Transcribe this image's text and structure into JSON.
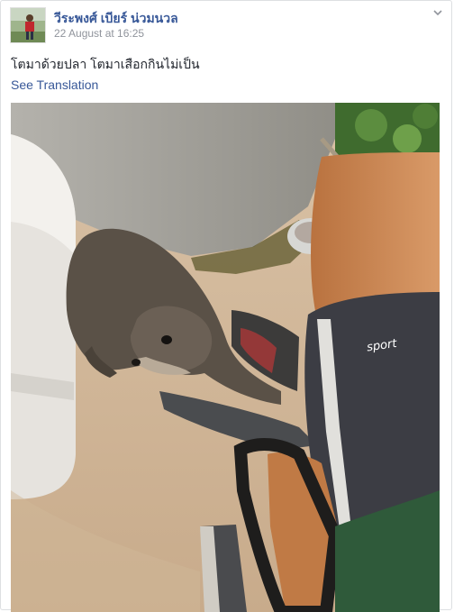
{
  "post": {
    "author_name": "วีระพงศ์ เบียร์ น่วมนวล",
    "timestamp": "22 August at 16:25",
    "text": "โตมาด้วยปลา โตมาเสือกกินไม่เป็น",
    "see_translation_label": "See Translation",
    "photo": {
      "shorts_brand_text": "sport"
    }
  },
  "colors": {
    "link": "#385898",
    "meta": "#90949c",
    "text": "#1d2129",
    "border": "#dddfe2"
  },
  "icons": {
    "options": "chevron-down-icon"
  }
}
